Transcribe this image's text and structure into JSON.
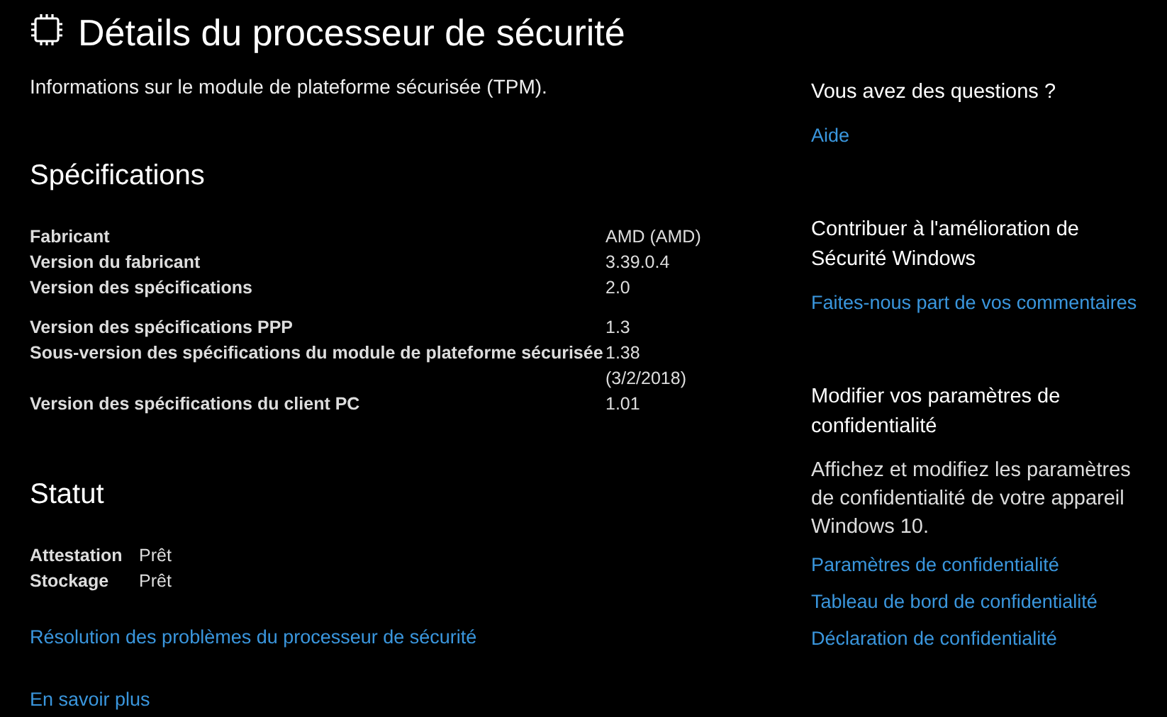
{
  "title": "Détails du processeur de sécurité",
  "subtitle": "Informations sur le module de plateforme sécurisée (TPM).",
  "specifications": {
    "heading": "Spécifications",
    "groups": [
      {
        "rows": [
          {
            "label": "Fabricant",
            "value": "AMD (AMD)"
          },
          {
            "label": "Version du fabricant",
            "value": "3.39.0.4"
          },
          {
            "label": "Version des spécifications",
            "value": "2.0"
          }
        ]
      },
      {
        "rows": [
          {
            "label": "Version des spécifications PPP",
            "value": "1.3"
          },
          {
            "label": "Sous-version des spécifications du module de plateforme sécurisée",
            "value": "1.38 (3/2/2018)"
          },
          {
            "label": "Version des spécifications du client PC",
            "value": "1.01"
          }
        ]
      }
    ]
  },
  "status": {
    "heading": "Statut",
    "rows": [
      {
        "label": "Attestation",
        "value": "Prêt"
      },
      {
        "label": "Stockage",
        "value": "Prêt"
      }
    ],
    "links": [
      "Résolution des problèmes du processeur de sécurité",
      "En savoir plus"
    ]
  },
  "sidebar": [
    {
      "heading": "Vous avez des questions ?",
      "links": [
        "Aide"
      ]
    },
    {
      "heading": "Contribuer à l'amélioration de Sécurité Windows",
      "links": [
        "Faites-nous part de vos commentaires"
      ]
    },
    {
      "heading": "Modifier vos paramètres de confidentialité",
      "text": "Affichez et modifiez les paramètres de confidentialité de votre appareil Windows 10.",
      "links": [
        "Paramètres de confidentialité",
        "Tableau de bord de confidentialité",
        "Déclaration de confidentialité"
      ]
    }
  ]
}
